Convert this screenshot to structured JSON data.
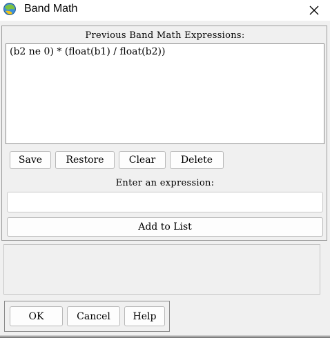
{
  "window": {
    "title": "Band Math",
    "close_glyph": "✕"
  },
  "expressions": {
    "label": "Previous Band Math Expressions:",
    "items": [
      "(b2 ne 0) * (float(b1) / float(b2))"
    ]
  },
  "list_buttons": {
    "save": "Save",
    "restore": "Restore",
    "clear": "Clear",
    "delete": "Delete"
  },
  "entry": {
    "label": "Enter an expression:",
    "value": "",
    "add_to_list": "Add to List"
  },
  "dialog_buttons": {
    "ok": "OK",
    "cancel": "Cancel",
    "help": "Help"
  },
  "icons": {
    "app": "envi-globe-icon",
    "close": "close-icon"
  }
}
